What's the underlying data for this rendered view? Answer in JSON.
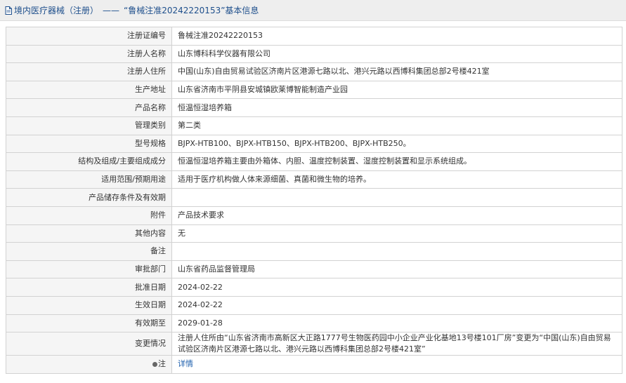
{
  "header": {
    "category": "境内医疗器械（注册）",
    "separator": "——",
    "record_title": "“鲁械注准20242220153”基本信息"
  },
  "rows": [
    {
      "label": "注册证编号",
      "value": "鲁械注准20242220153"
    },
    {
      "label": "注册人名称",
      "value": "山东博科科学仪器有限公司"
    },
    {
      "label": "注册人住所",
      "value": "中国(山东)自由贸易试验区济南片区港源七路以北、港兴元路以西博科集团总部2号楼421室"
    },
    {
      "label": "生产地址",
      "value": "山东省济南市平阴县安城镇欧莱博智能制造产业园"
    },
    {
      "label": "产品名称",
      "value": "恒温恒湿培养箱"
    },
    {
      "label": "管理类别",
      "value": "第二类"
    },
    {
      "label": "型号规格",
      "value": "BJPX-HTB100、BJPX-HTB150、BJPX-HTB200、BJPX-HTB250。"
    },
    {
      "label": "结构及组成/主要组成成分",
      "value": "恒温恒湿培养箱主要由外箱体、内胆、温度控制装置、湿度控制装置和显示系统组成。"
    },
    {
      "label": "适用范围/预期用途",
      "value": "适用于医疗机构做人体来源细菌、真菌和微生物的培养。"
    },
    {
      "label": "产品储存条件及有效期",
      "value": ""
    },
    {
      "label": "附件",
      "value": "产品技术要求"
    },
    {
      "label": "其他内容",
      "value": "无"
    },
    {
      "label": "备注",
      "value": ""
    },
    {
      "label": "审批部门",
      "value": "山东省药品监督管理局"
    },
    {
      "label": "批准日期",
      "value": "2024-02-22"
    },
    {
      "label": "生效日期",
      "value": "2024-02-22"
    },
    {
      "label": "有效期至",
      "value": "2029-01-28"
    },
    {
      "label": "变更情况",
      "value": "注册人住所由“山东省济南市高新区大正路1777号生物医药园中小企业产业化基地13号楼101厂房”变更为“中国(山东)自由贸易试验区济南片区港源七路以北、港兴元路以西博科集团总部2号楼421室”"
    }
  ],
  "note": {
    "label": "注",
    "link_text": "详情"
  }
}
